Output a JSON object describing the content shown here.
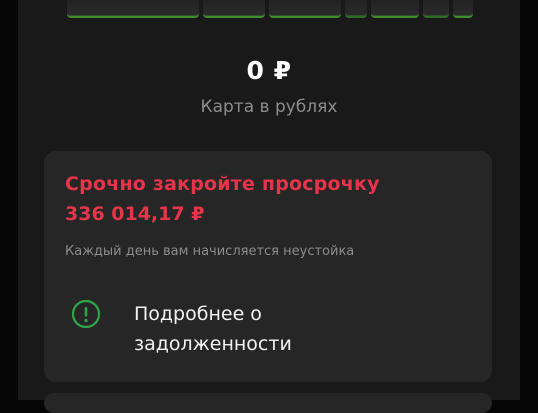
{
  "account": {
    "balance": "0 ₽",
    "label": "Карта в рублях"
  },
  "debt_alert": {
    "title": "Срочно закройте просрочку",
    "amount": "336 014,17 ₽",
    "note": "Каждый день вам начисляется неустойка",
    "details_label": "Подробнее о задолженности",
    "icon": "info-exclamation-icon",
    "alert_color": "#e6344a",
    "icon_color": "#2fa64a"
  },
  "colors": {
    "background": "#191919",
    "card_background": "#262626",
    "text_primary": "#ffffff",
    "text_secondary": "#8d8d8d"
  }
}
